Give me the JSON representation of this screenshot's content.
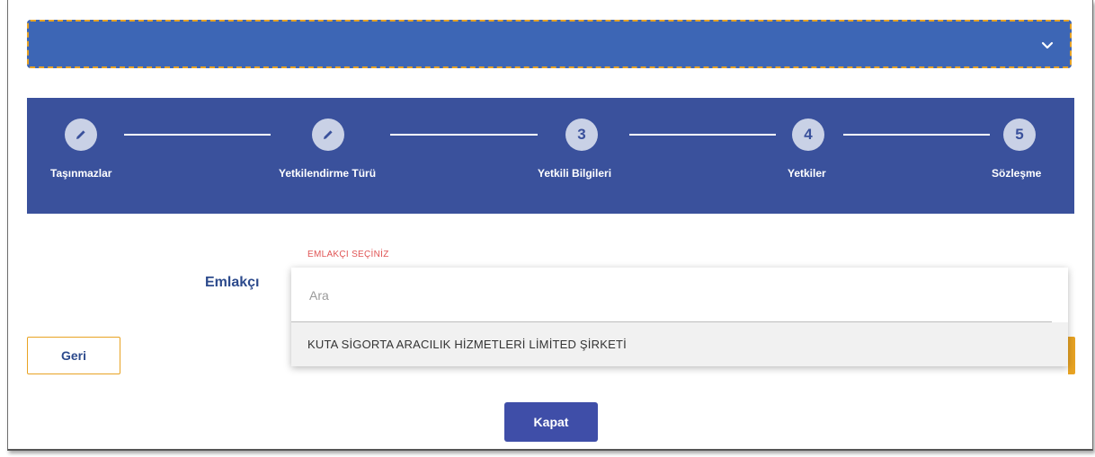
{
  "accordion": {
    "icon": "chevron-down-icon"
  },
  "stepper": {
    "steps": [
      {
        "label": "Taşınmazlar",
        "marker": "",
        "icon": "pencil-icon",
        "status": "completed"
      },
      {
        "label": "Yetkilendirme Türü",
        "marker": "",
        "icon": "pencil-icon",
        "status": "completed"
      },
      {
        "label": "Yetkili Bilgileri",
        "marker": "3",
        "status": "pending"
      },
      {
        "label": "Yetkiler",
        "marker": "4",
        "status": "pending"
      },
      {
        "label": "Sözleşme",
        "marker": "5",
        "status": "pending"
      }
    ]
  },
  "form": {
    "hint": "EMLAKÇI SEÇİNİZ",
    "label": "Emlakçı",
    "search_placeholder": "Ara",
    "options": [
      "KUTA SİGORTA ARACILIK HİZMETLERİ LİMİTED ŞİRKETİ"
    ]
  },
  "actions": {
    "back_label": "Geri",
    "close_label": "Kapat"
  },
  "colors": {
    "accordion_bg": "#3d66b5",
    "accent_orange": "#e8a323",
    "stepper_bg": "#3a519c",
    "primary_button": "#3f4ea8",
    "hint_red": "#e05555"
  }
}
